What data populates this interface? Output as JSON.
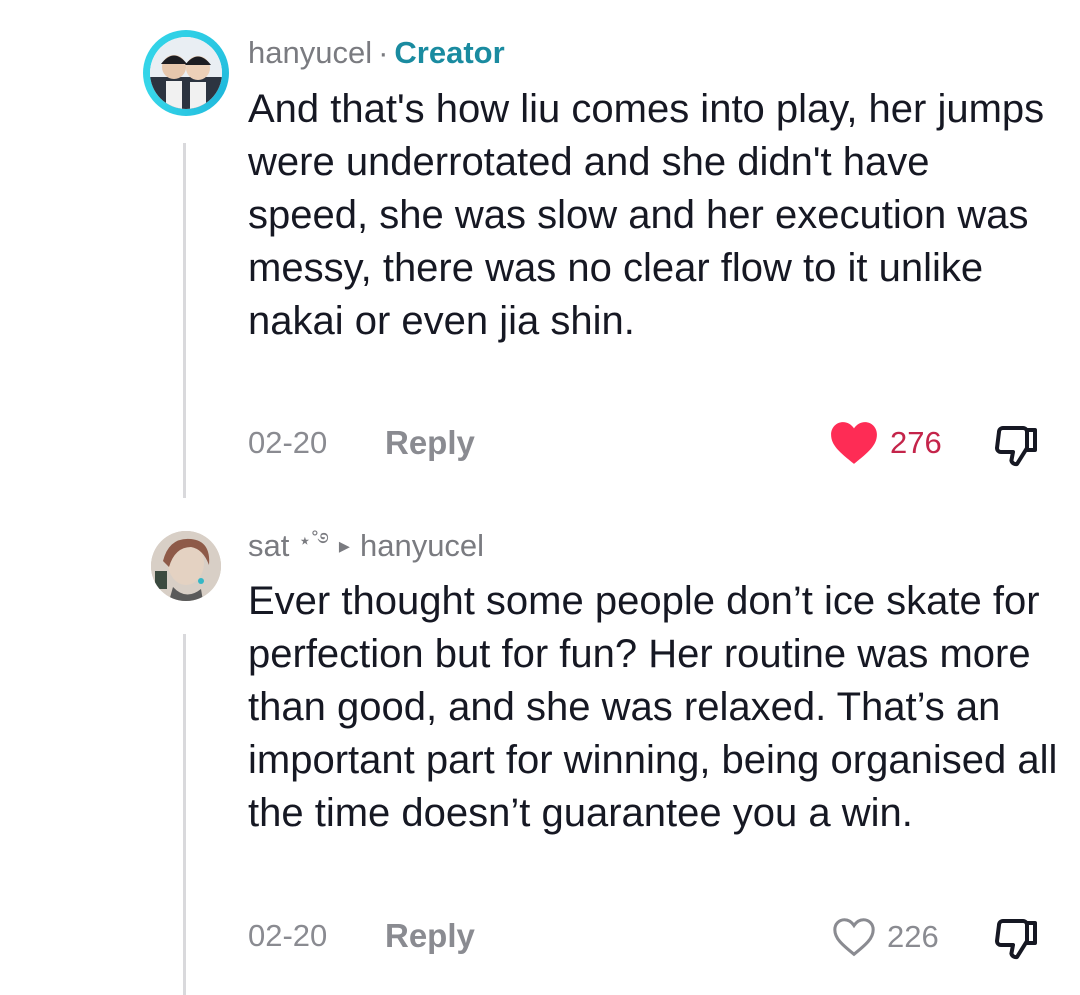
{
  "comments": [
    {
      "username": "hanyucel",
      "separator": "·",
      "badge": "Creator",
      "text": "And that's how liu comes into play, her jumps were underrotated and she didn't have speed, she was slow and her execution was messy, there was no clear flow to it unlike nakai or even jia shin.",
      "date": "02-20",
      "reply_label": "Reply",
      "likes": "276",
      "liked": true,
      "like_color": "#fe2c55",
      "icons": {
        "like": "heart-filled-icon",
        "dislike": "thumbs-down-icon"
      }
    },
    {
      "username": "sat",
      "username_decoration": "⋆˚࿔",
      "reply_arrow": "▸",
      "reply_to": "hanyucel",
      "text": "Ever thought some people don’t ice skate for perfection but for fun? Her routine was more than good, and she was relaxed. That’s an important part for winning, being organised all the time doesn’t guarantee you a win.",
      "date": "02-20",
      "reply_label": "Reply",
      "likes": "226",
      "liked": false,
      "icons": {
        "like": "heart-outline-icon",
        "dislike": "thumbs-down-icon"
      }
    }
  ],
  "colors": {
    "creator_badge": "#1a8ba0",
    "secondary_text": "#8a8b91",
    "body_text": "#161823",
    "avatar_ring": "#2fd0e6"
  }
}
